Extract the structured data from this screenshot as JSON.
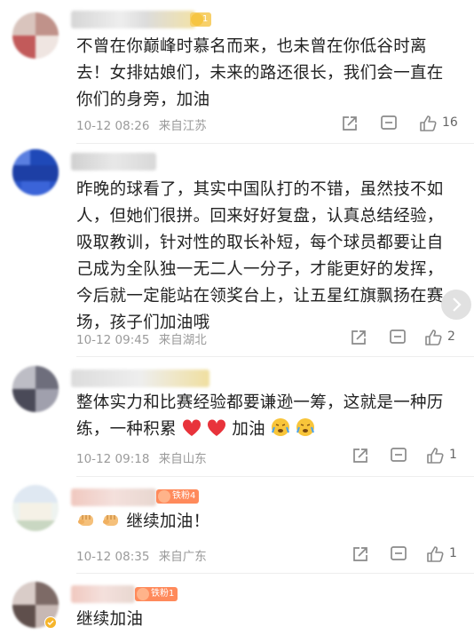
{
  "comments": [
    {
      "text": "不曾在你巅峰时慕名而来，也未曾在你低谷时离去！女排姑娘们，未来的路还很长，我们会一直在你们的身旁，加油",
      "lines": [
        "不曾在你巅峰时慕名而来，也未曾在你低谷时离",
        "去！女排姑娘们，未来的路还很长，我们会一直在",
        "你们的身旁，加油"
      ],
      "date": "10-12 08:26",
      "location": "来自江苏",
      "likes": "16",
      "badge": "1"
    },
    {
      "lines": [
        "昨晚的球看了，其实中国队打的不错，虽然技不如",
        "人，但她们很拼。回来好好复盘，认真总结经验，",
        "吸取教训，针对性的取长补短，每个球员都要让自",
        "己成为全队独一无二人一分子，才能更好的发挥，",
        "今后就一定能站在领奖台上，让五星红旗飘扬在赛",
        "场，孩子们加油哦"
      ],
      "date": "10-12 09:45",
      "location": "来自湖北",
      "likes": "2"
    },
    {
      "lines": [
        "整体实力和比赛经验都要谦逊一筹，这就是一种历",
        "练，一种积累"
      ],
      "suffix": "加油",
      "date": "10-12 09:18",
      "location": "来自山东",
      "likes": "1"
    },
    {
      "lines": [
        "继续加油！"
      ],
      "date": "10-12 08:35",
      "location": "来自广东",
      "likes": "1",
      "badge": "铁粉4"
    },
    {
      "lines": [
        "继续加油"
      ],
      "badge": "铁粉1"
    }
  ],
  "colors": {
    "heart": "#e8333b",
    "badge_orange": "#f5a623",
    "badge_red": "#ff7e4f",
    "icon_gray": "#8a8a8a"
  },
  "icons": {
    "forward": "share-box-icon",
    "comment": "comment-bubble-icon",
    "like": "thumbs-up-icon"
  }
}
